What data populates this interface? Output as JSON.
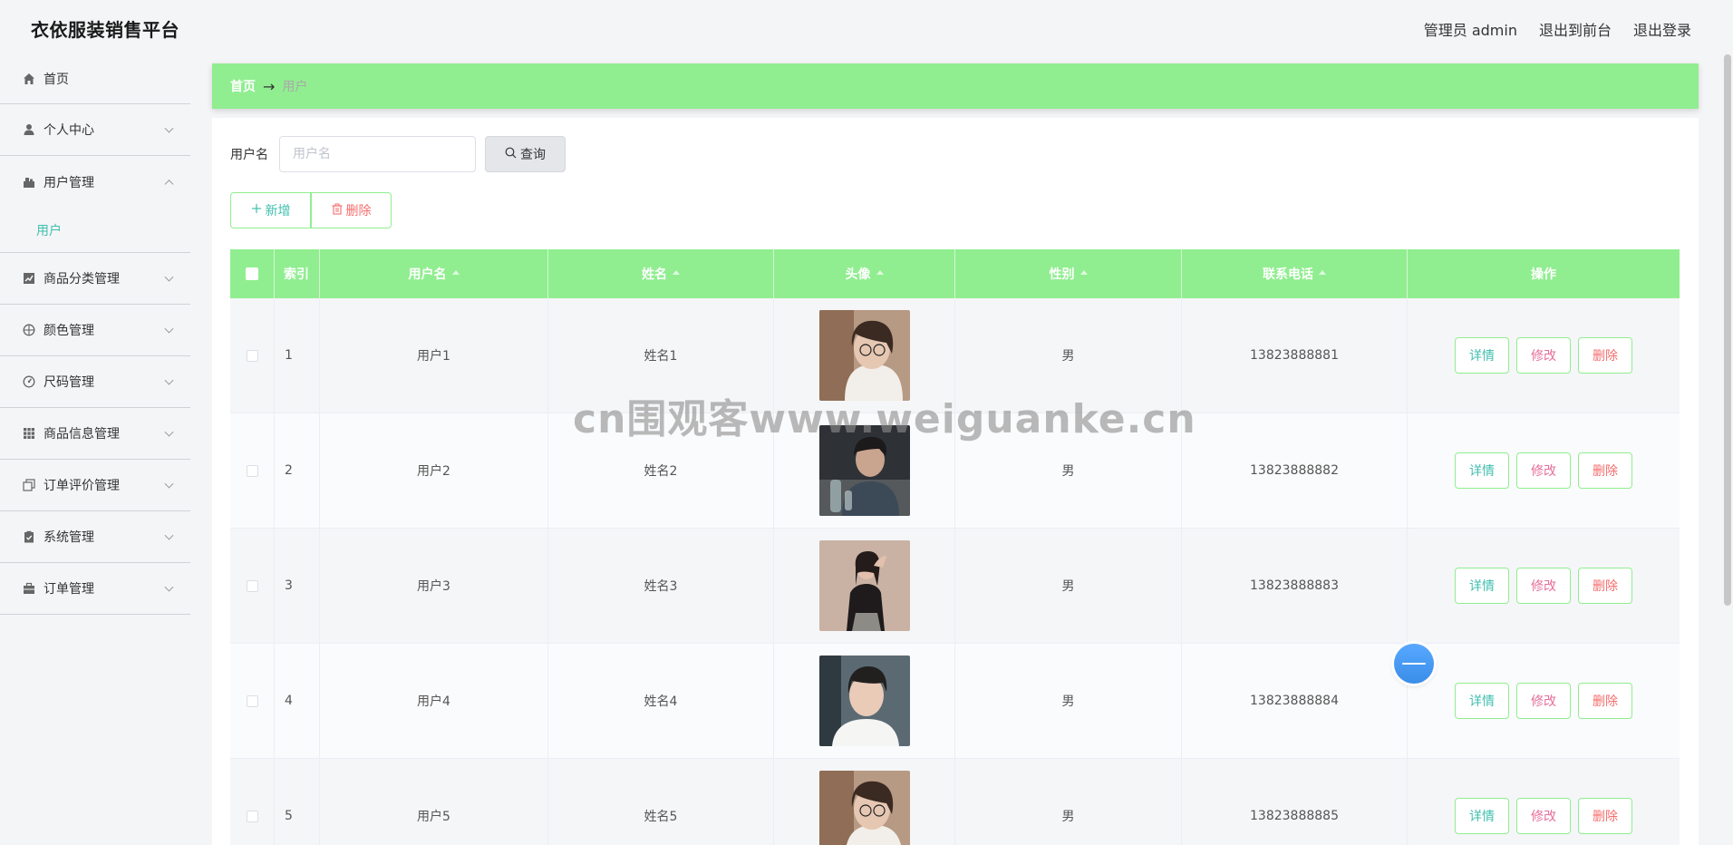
{
  "brand": "衣依服装销售平台",
  "top_links": {
    "admin": "管理员 admin",
    "frontend": "退出到前台",
    "logout": "退出登录"
  },
  "sidebar": {
    "items": [
      {
        "label": "首页",
        "icon": "home-icon"
      },
      {
        "label": "个人中心",
        "icon": "user-icon"
      },
      {
        "label": "用户管理",
        "icon": "users-icon",
        "expanded": true,
        "children": [
          "用户"
        ]
      },
      {
        "label": "商品分类管理",
        "icon": "chart-icon"
      },
      {
        "label": "颜色管理",
        "icon": "palette-icon"
      },
      {
        "label": "尺码管理",
        "icon": "gauge-icon"
      },
      {
        "label": "商品信息管理",
        "icon": "grid-icon"
      },
      {
        "label": "订单评价管理",
        "icon": "copy-icon"
      },
      {
        "label": "系统管理",
        "icon": "clipboard-icon"
      },
      {
        "label": "订单管理",
        "icon": "briefcase-icon"
      }
    ]
  },
  "breadcrumb": {
    "home": "首页",
    "separator": "→",
    "current": "用户"
  },
  "search": {
    "label": "用户名",
    "placeholder": "用户名",
    "value": "",
    "button": "查询"
  },
  "actions": {
    "add": "新增",
    "delete": "删除"
  },
  "table": {
    "headers": {
      "index": "索引",
      "username": "用户名",
      "name": "姓名",
      "avatar": "头像",
      "gender": "性别",
      "phone": "联系电话",
      "op": "操作"
    },
    "rows": [
      {
        "index": "1",
        "username": "用户1",
        "name": "姓名1",
        "gender": "男",
        "phone": "13823888881"
      },
      {
        "index": "2",
        "username": "用户2",
        "name": "姓名2",
        "gender": "男",
        "phone": "13823888882"
      },
      {
        "index": "3",
        "username": "用户3",
        "name": "姓名3",
        "gender": "男",
        "phone": "13823888883"
      },
      {
        "index": "4",
        "username": "用户4",
        "name": "姓名4",
        "gender": "男",
        "phone": "13823888884"
      },
      {
        "index": "5",
        "username": "用户5",
        "name": "姓名5",
        "gender": "男",
        "phone": "13823888885"
      }
    ],
    "row_buttons": {
      "detail": "详情",
      "edit": "修改",
      "remove": "删除"
    }
  },
  "watermark": "cn围观客www.weiguanke.cn",
  "colors": {
    "accent_green": "#90ee90",
    "teal_text": "#3fbfae",
    "danger": "#f56c6c",
    "edit_pink": "#e66e9a"
  }
}
